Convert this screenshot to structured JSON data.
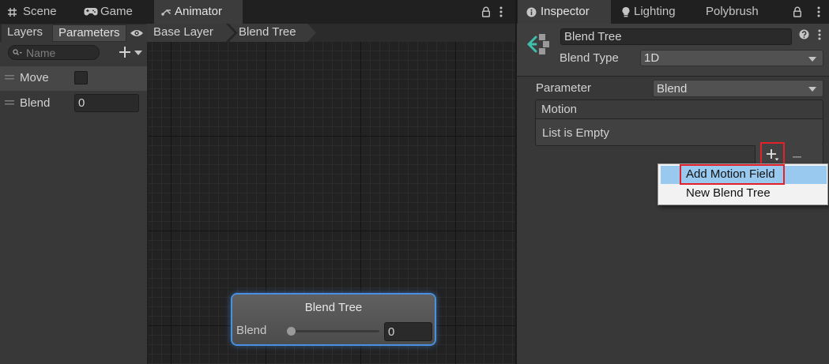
{
  "animator_window": {
    "tabs": [
      {
        "label": "Scene",
        "icon": "grid-icon",
        "active": false
      },
      {
        "label": "Game",
        "icon": "gamepad-icon",
        "active": false
      },
      {
        "label": "Animator",
        "icon": "animator-icon",
        "active": true
      }
    ],
    "sidebar_tabs": [
      {
        "label": "Layers",
        "active": false
      },
      {
        "label": "Parameters",
        "active": true
      }
    ],
    "search": {
      "placeholder": "Name",
      "value": ""
    },
    "parameters": [
      {
        "name": "Move",
        "checked": false,
        "highlighted": true
      },
      {
        "name": "Blend",
        "value": "0",
        "highlighted": false
      }
    ],
    "breadcrumb": [
      "Base Layer",
      "Blend Tree"
    ],
    "node": {
      "title": "Blend Tree",
      "parameter": "Blend",
      "value": "0",
      "slider_level": 0,
      "selected": true
    }
  },
  "inspector_window": {
    "tabs": [
      {
        "label": "Inspector",
        "icon": "info-icon",
        "active": true
      },
      {
        "label": "Lighting",
        "icon": "bulb-icon",
        "active": false
      },
      {
        "label": "Polybrush",
        "active": false
      }
    ],
    "header_icon": "blend-tree-icon",
    "object_name": "Blend Tree",
    "blend_type": {
      "label": "Blend Type",
      "value": "1D"
    },
    "parameter": {
      "label": "Parameter",
      "value": "Blend"
    },
    "motion_list": {
      "header": "Motion",
      "empty_text": "List is Empty"
    },
    "list_buttons": {
      "add_icon": "plus-dropdown-icon",
      "remove_icon": "minus-icon"
    },
    "context_menu": {
      "items": [
        {
          "label": "Add Motion Field",
          "highlighted": true
        },
        {
          "label": "New Blend Tree",
          "highlighted": false
        }
      ]
    }
  },
  "colors": {
    "selection_outline": "#4a90e2",
    "menu_highlight": "#99c9ef",
    "annotation_red": "#e3212b",
    "blend_tree_icon": "#3fbfae"
  }
}
